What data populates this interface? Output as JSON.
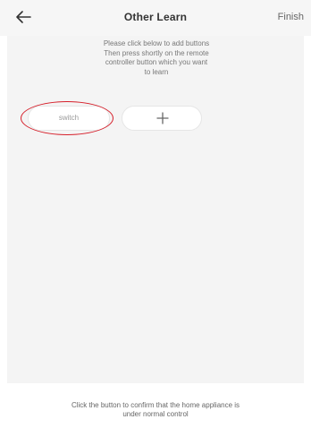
{
  "header": {
    "title": "Other Learn",
    "finish_label": "Finish",
    "back_icon": "left-arrow-icon"
  },
  "instructions": [
    "Please click below to add buttons",
    "Then press shortly on the remote",
    "controller button which you want",
    "to learn"
  ],
  "buttons": {
    "switch_label": "switch",
    "add_icon": "plus-icon"
  },
  "footer": {
    "line1": "Click the button to confirm that the home appliance is",
    "line2": "under normal control"
  },
  "colors": {
    "highlight": "#d61f2a",
    "panel": "#f4f4f4"
  }
}
